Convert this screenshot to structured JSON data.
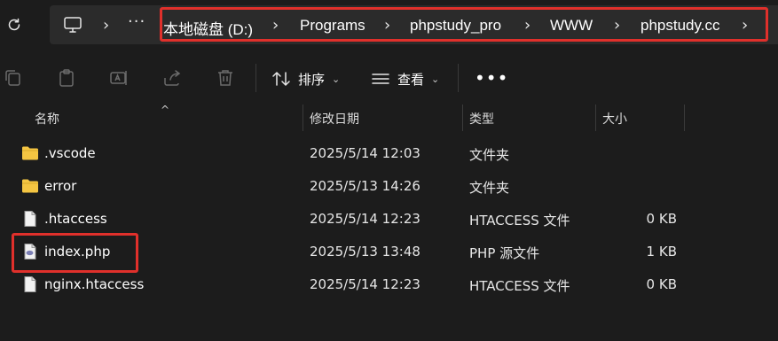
{
  "address": {
    "more_label": "···",
    "crumbs": [
      "本地磁盘 (D:)",
      "Programs",
      "phpstudy_pro",
      "WWW",
      "phpstudy.cc"
    ]
  },
  "toolbar": {
    "sort_label": "排序",
    "view_label": "查看",
    "more_label": "•••"
  },
  "columns": {
    "name": "名称",
    "modified": "修改日期",
    "type": "类型",
    "size": "大小"
  },
  "files": [
    {
      "name": ".vscode",
      "modified": "2025/5/14 12:03",
      "type": "文件夹",
      "size": "",
      "icon": "folder-icon"
    },
    {
      "name": "error",
      "modified": "2025/5/13 14:26",
      "type": "文件夹",
      "size": "",
      "icon": "folder-icon"
    },
    {
      "name": ".htaccess",
      "modified": "2025/5/14 12:23",
      "type": "HTACCESS 文件",
      "size": "0 KB",
      "icon": "file-icon"
    },
    {
      "name": "index.php",
      "modified": "2025/5/13 13:48",
      "type": "PHP 源文件",
      "size": "1 KB",
      "icon": "php-file-icon"
    },
    {
      "name": "nginx.htaccess",
      "modified": "2025/5/14 12:23",
      "type": "HTACCESS 文件",
      "size": "0 KB",
      "icon": "file-icon"
    }
  ],
  "colors": {
    "background": "#1c1c1c",
    "address_bg": "#2b2b2b",
    "highlight": "#e0302b",
    "folder": "#f4c542"
  }
}
